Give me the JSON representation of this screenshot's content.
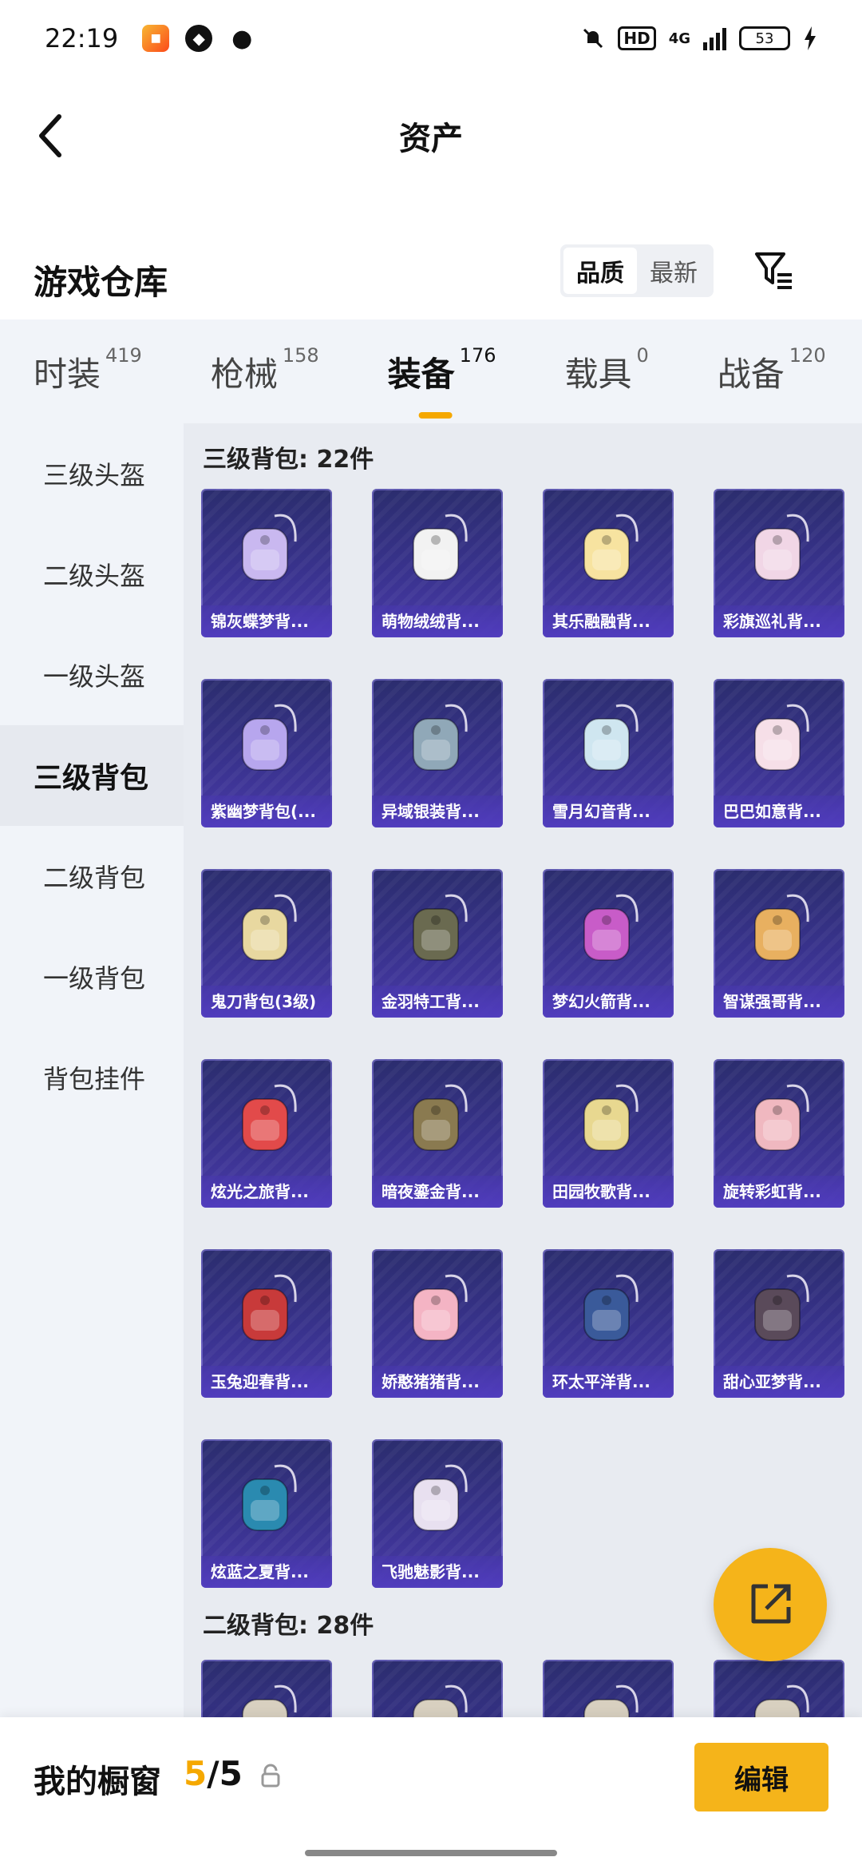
{
  "status": {
    "time": "22:19",
    "battery": "53",
    "hd": "HD",
    "net": "4G"
  },
  "header": {
    "title": "资产"
  },
  "section": {
    "title": "游戏仓库",
    "sort_options": [
      "品质",
      "最新"
    ],
    "sort_active": "品质"
  },
  "tabs": [
    {
      "label": "时装",
      "count": "419"
    },
    {
      "label": "枪械",
      "count": "158"
    },
    {
      "label": "装备",
      "count": "176"
    },
    {
      "label": "载具",
      "count": "0"
    },
    {
      "label": "战备",
      "count": "120"
    }
  ],
  "active_tab": "装备",
  "categories": [
    "三级头盔",
    "二级头盔",
    "一级头盔",
    "三级背包",
    "二级背包",
    "一级背包",
    "背包挂件"
  ],
  "active_category": "三级背包",
  "groups": [
    {
      "title": "三级背包: 22件",
      "items": [
        {
          "name": "锦灰蝶梦背...",
          "icon": "butterfly-backpack-icon"
        },
        {
          "name": "萌物绒绒背...",
          "icon": "plush-backpack-icon"
        },
        {
          "name": "其乐融融背...",
          "icon": "cake-backpack-icon"
        },
        {
          "name": "彩旗巡礼背...",
          "icon": "flag-backpack-icon"
        },
        {
          "name": "紫幽梦背包(...",
          "icon": "purple-backpack-icon"
        },
        {
          "name": "异域银装背...",
          "icon": "silver-backpack-icon"
        },
        {
          "name": "雪月幻音背...",
          "icon": "snow-backpack-icon"
        },
        {
          "name": "巴巴如意背...",
          "icon": "lucky-backpack-icon"
        },
        {
          "name": "鬼刀背包(3级)",
          "icon": "blade-backpack-icon"
        },
        {
          "name": "金羽特工背...",
          "icon": "agent-backpack-icon"
        },
        {
          "name": "梦幻火箭背...",
          "icon": "rocket-backpack-icon"
        },
        {
          "name": "智谋强哥背...",
          "icon": "clever-backpack-icon"
        },
        {
          "name": "炫光之旅背...",
          "icon": "dino-backpack-icon"
        },
        {
          "name": "暗夜鎏金背...",
          "icon": "night-backpack-icon"
        },
        {
          "name": "田园牧歌背...",
          "icon": "basket-backpack-icon"
        },
        {
          "name": "旋转彩虹背...",
          "icon": "rainbow-backpack-icon"
        },
        {
          "name": "玉兔迎春背...",
          "icon": "rabbit-backpack-icon"
        },
        {
          "name": "娇憨猪猪背...",
          "icon": "piggy-backpack-icon"
        },
        {
          "name": "环太平洋背...",
          "icon": "mecha-backpack-icon"
        },
        {
          "name": "甜心亚梦背...",
          "icon": "sweet-backpack-icon"
        },
        {
          "name": "炫蓝之夏背...",
          "icon": "blue-backpack-icon"
        },
        {
          "name": "飞驰魅影背...",
          "icon": "phantom-backpack-icon"
        }
      ]
    },
    {
      "title": "二级背包: 28件",
      "items": []
    }
  ],
  "bottom": {
    "showcase_label": "我的橱窗",
    "current": "5",
    "total": "/5",
    "edit_label": "编辑"
  },
  "colors": {
    "accent": "#f5b41a",
    "card_bg": "#3a3390"
  }
}
